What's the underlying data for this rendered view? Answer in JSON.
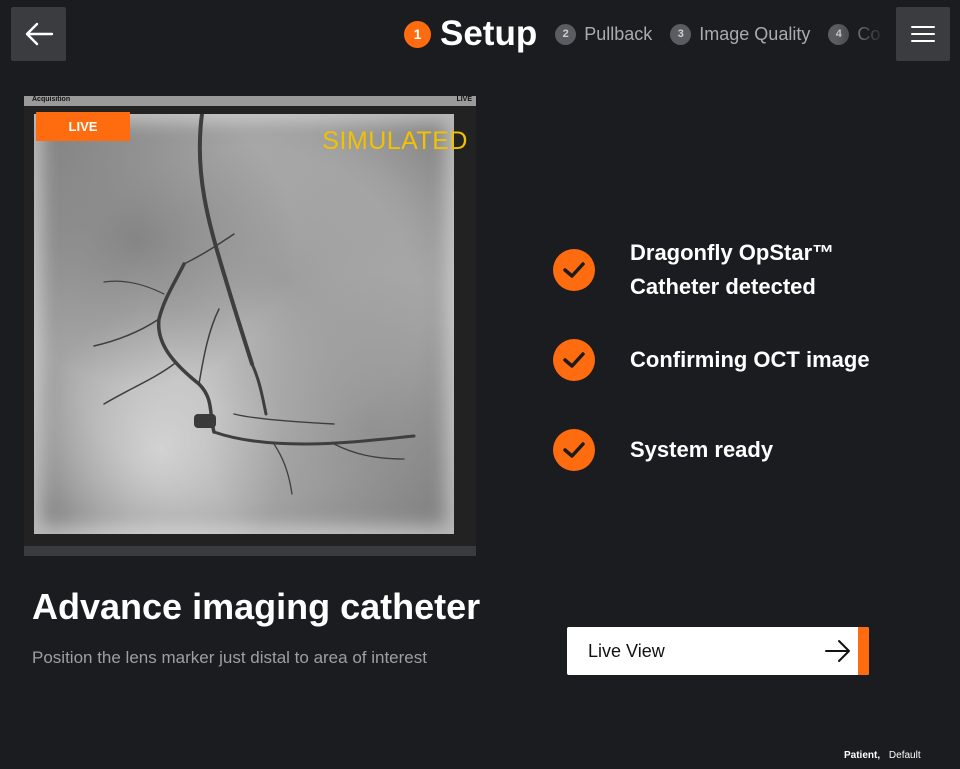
{
  "header": {
    "steps": [
      {
        "number": "1",
        "label": "Setup",
        "state": "active"
      },
      {
        "number": "2",
        "label": "Pullback",
        "state": "inactive"
      },
      {
        "number": "3",
        "label": "Image Quality",
        "state": "inactive"
      },
      {
        "number": "4",
        "label": "Co",
        "state": "inactive"
      }
    ]
  },
  "angio": {
    "acquisition_label": "Acquisition",
    "live_small_label": "LIVE",
    "live_badge": "LIVE",
    "simulated_watermark": "SIMULATED"
  },
  "instruction": {
    "title": "Advance imaging catheter",
    "subtitle": "Position the lens marker just distal to area of interest"
  },
  "checklist": [
    {
      "line1": "Dragonfly OpStar™",
      "line2": "Catheter detected",
      "status": "complete"
    },
    {
      "line1": "Confirming OCT image",
      "line2": "",
      "status": "complete"
    },
    {
      "line1": "System ready",
      "line2": "",
      "status": "complete"
    }
  ],
  "live_view_button": {
    "label": "Live View"
  },
  "footer": {
    "patient_label": "Patient,",
    "patient_value": "Default"
  },
  "colors": {
    "accent": "#ff6b0f",
    "background": "#1b1c20",
    "watermark": "#f2c100"
  },
  "icons": {
    "back": "arrow-left-icon",
    "menu": "hamburger-menu-icon",
    "check": "checkmark-icon",
    "forward": "arrow-right-icon"
  }
}
